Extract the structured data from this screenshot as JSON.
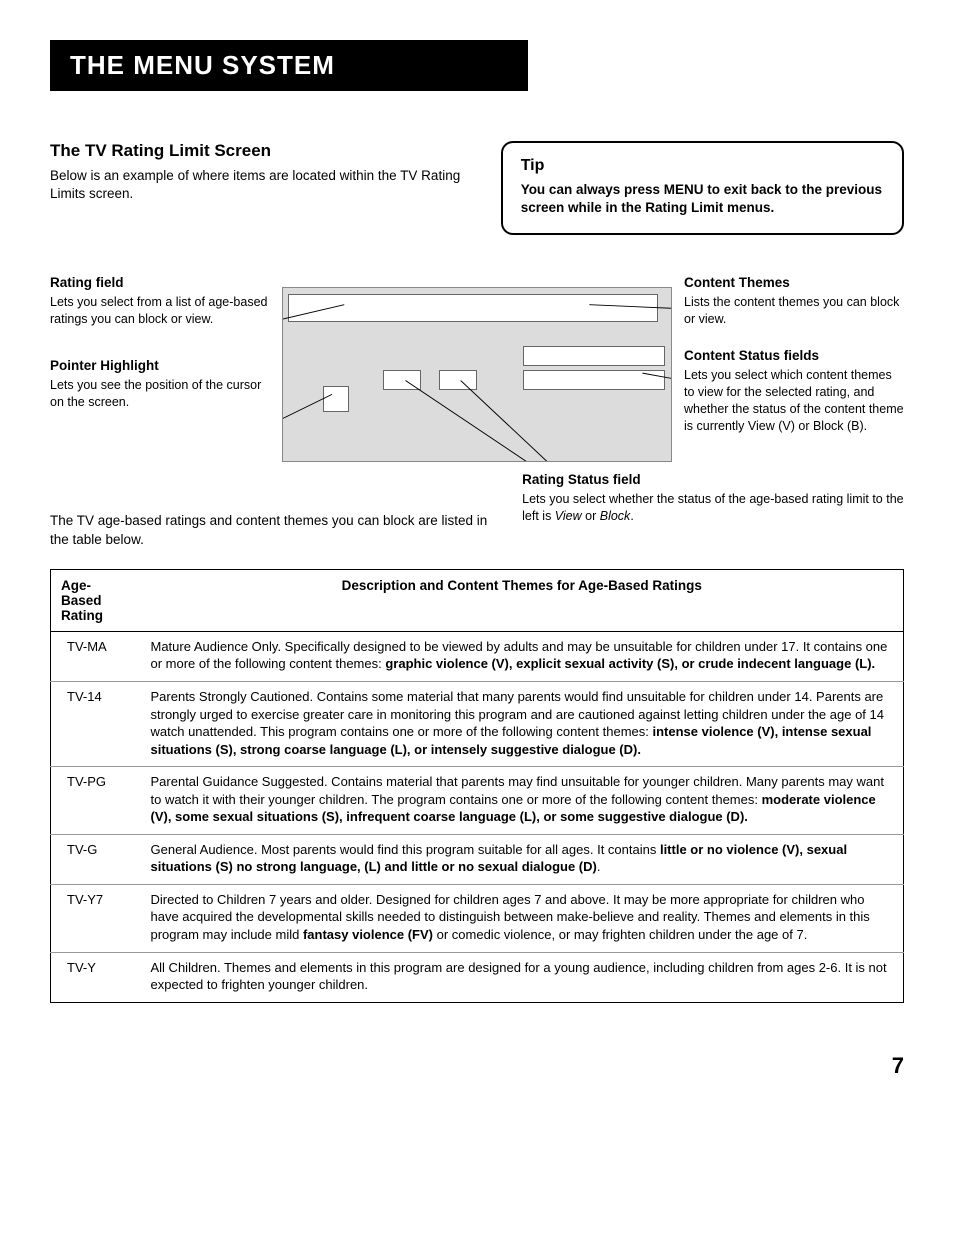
{
  "header": {
    "title": "The Menu System"
  },
  "intro": {
    "heading": "The TV Rating Limit Screen",
    "body": "Below is an example of where items are located within the TV Rating Limits screen."
  },
  "tip": {
    "heading": "Tip",
    "body": "You can always press MENU to exit back to the previous screen while in the Rating Limit menus."
  },
  "callouts": {
    "rating_field": {
      "title": "Rating field",
      "body": "Lets you select from a list of age-based ratings you can block or view."
    },
    "pointer_highlight": {
      "title": "Pointer Highlight",
      "body": "Lets you see the position of the cursor on the screen."
    },
    "content_themes": {
      "title": "Content Themes",
      "body": "Lists the content themes you can block or view."
    },
    "content_status": {
      "title": "Content Status fields",
      "body": "Lets you select which content themes to view for the selected rating, and whether the status of the content theme is currently View (V) or Block (B)."
    },
    "rating_status": {
      "title": "Rating Status field",
      "body_prefix": "Lets you select whether the status of the age-based rating limit to the left is ",
      "view_word": "View",
      "mid": " or ",
      "block_word": "Block",
      "suffix": "."
    }
  },
  "table_intro": "The TV age-based ratings and content themes you can block are listed in the table below.",
  "table": {
    "col1_header": "Age-Based Rating",
    "col2_header": "Description and Content Themes for Age-Based Ratings",
    "rows": [
      {
        "rating": "TV-MA",
        "desc_plain": "Mature Audience Only. Specifically designed to be viewed by adults and may be unsuitable for children under 17.  It contains one or more of the following content themes:  ",
        "desc_bold": "graphic violence (V), explicit sexual activity (S), or crude indecent language (L)."
      },
      {
        "rating": "TV-14",
        "desc_plain": "Parents Strongly Cautioned. Contains some material that many parents would find unsuitable for children under 14.  Parents are strongly urged to exercise greater care in monitoring this program and are cautioned against letting children under the age of 14 watch unattended.  This program contains one or more of the following content themes:  ",
        "desc_bold": "intense violence (V), intense sexual situations (S), strong coarse language (L), or intensely suggestive dialogue (D)."
      },
      {
        "rating": "TV-PG",
        "desc_plain": "Parental Guidance Suggested. Contains material that parents may find unsuitable for younger children.  Many parents may want to watch it with their younger children.  The program contains one or more of the following content themes:  ",
        "desc_bold": "moderate violence (V), some sexual situations (S), infrequent coarse language (L), or some suggestive dialogue (D)."
      },
      {
        "rating": "TV-G",
        "desc_plain": "General Audience. Most parents would find this program suitable for all ages.  It contains ",
        "desc_bold": "little or no violence (V), sexual situations (S) no strong language, (L) and little or no sexual dialogue (D)",
        "desc_tail": "."
      },
      {
        "rating": "TV-Y7",
        "desc_plain": "Directed to Children 7 years and older. Designed for children ages 7 and above.  It may be more appropriate for children who have acquired the developmental skills needed to distinguish between make-believe and reality.  Themes and elements in this program may include mild ",
        "desc_bold": "fantasy violence (FV)",
        "desc_tail": " or comedic violence, or may frighten children under the age of 7."
      },
      {
        "rating": "TV-Y",
        "desc_plain": "All Children. Themes and elements in this program are designed for a young audience, including children from ages 2-6.  It is not expected to frighten younger children.",
        "desc_bold": ""
      }
    ]
  },
  "page_number": "7"
}
